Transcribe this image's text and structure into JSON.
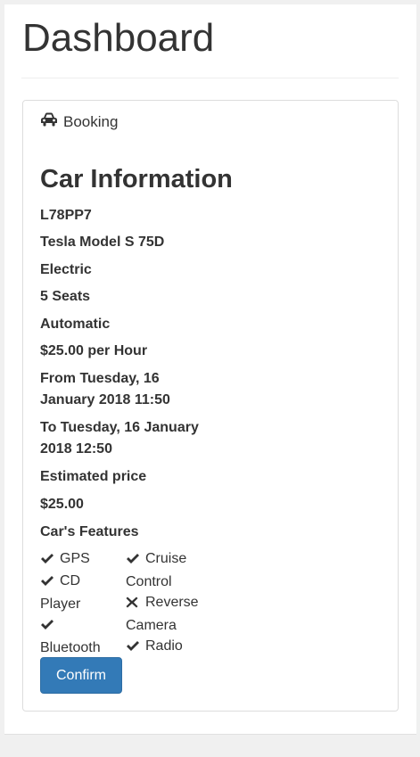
{
  "page": {
    "title": "Dashboard"
  },
  "panel": {
    "heading": "Booking",
    "heading_icon": "car-icon"
  },
  "car": {
    "section_title": "Car Information",
    "plate": "L78PP7",
    "model": "Tesla Model S 75D",
    "fuel": "Electric",
    "seats": "5 Seats",
    "transmission": "Automatic",
    "rate": "$25.00 per Hour",
    "from_line1": "From Tuesday, 16",
    "from_line2": "January 2018 11:50",
    "to_line1": "To Tuesday, 16 January",
    "to_line2": "2018 12:50",
    "estimated_label": "Estimated price",
    "estimated_value": "$25.00"
  },
  "features": {
    "title": "Car's Features",
    "items": [
      {
        "icon": "check-icon",
        "line1": "GPS",
        "line2": ""
      },
      {
        "icon": "check-icon",
        "line1": "Cruise",
        "line2": "Control"
      },
      {
        "icon": "check-icon",
        "line1": "CD",
        "line2": "Player"
      },
      {
        "icon": "cross-icon",
        "line1": "Reverse",
        "line2": "Camera"
      },
      {
        "icon": "check-icon",
        "line1": "",
        "line2": "Bluetooth"
      },
      {
        "icon": "check-icon",
        "line1": "Radio",
        "line2": ""
      }
    ]
  },
  "actions": {
    "confirm_label": "Confirm"
  },
  "colors": {
    "primary": "#337ab7",
    "text": "#333333"
  }
}
